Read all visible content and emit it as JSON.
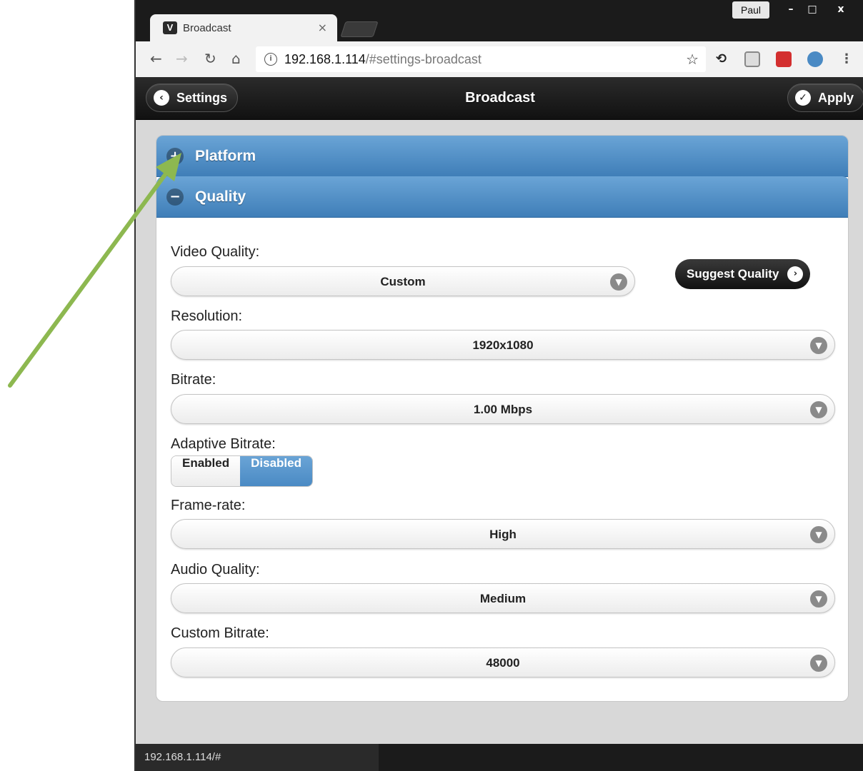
{
  "browser": {
    "tab_title": "Broadcast",
    "tab_close": "×",
    "favicon": "V",
    "profile": "Paul",
    "window_buttons": [
      "–",
      "□",
      "x"
    ],
    "url_host": "192.168.1.114",
    "url_path": "/#settings-broadcast",
    "status_url": "192.168.1.114/#",
    "nav_icons": [
      "arrow-left-icon",
      "arrow-right-icon",
      "reload-icon",
      "home-icon"
    ],
    "extension_icons": [
      "sync-icon",
      "shield-icon",
      "lastpass-icon",
      "network-icon",
      "menu-icon"
    ]
  },
  "header": {
    "back_label": "Settings",
    "title": "Broadcast",
    "apply_label": "Apply"
  },
  "sections": {
    "platform_label": "Platform",
    "quality_label": "Quality"
  },
  "fields": {
    "video_quality_label": "Video Quality:",
    "video_quality_value": "Custom",
    "suggest_label": "Suggest Quality",
    "resolution_label": "Resolution:",
    "resolution_value": "1920x1080",
    "bitrate_label": "Bitrate:",
    "bitrate_value": "1.00 Mbps",
    "adaptive_label": "Adaptive Bitrate:",
    "adaptive_enabled": "Enabled",
    "adaptive_disabled": "Disabled",
    "adaptive_selected": "Disabled",
    "framerate_label": "Frame-rate:",
    "framerate_value": "High",
    "audio_label": "Audio Quality:",
    "audio_value": "Medium",
    "custom_bitrate_label": "Custom Bitrate:",
    "custom_bitrate_value": "48000"
  },
  "colors": {
    "accent_blue": "#4a8ac4",
    "annotation_arrow": "#8db850",
    "header_dark": "#1b1b1b"
  }
}
